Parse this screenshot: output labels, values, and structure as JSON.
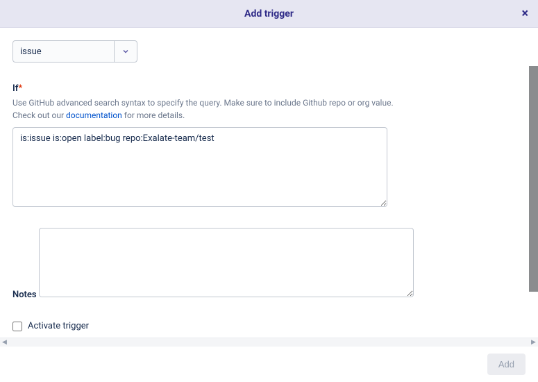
{
  "header": {
    "title": "Add trigger",
    "close_label": "×"
  },
  "entity_select": {
    "value": "issue"
  },
  "if_field": {
    "label": "If",
    "required_marker": "*",
    "help_prefix": "Use GitHub advanced search syntax to specify the query. Make sure to include Github repo or org value. Check out our ",
    "help_link_text": "documentation",
    "help_suffix": " for more details.",
    "value": "is:issue is:open label:bug repo:Exalate-team/test"
  },
  "notes_field": {
    "label": "Notes",
    "value": ""
  },
  "activate": {
    "label": "Activate trigger",
    "checked": false
  },
  "footer": {
    "add_label": "Add"
  }
}
